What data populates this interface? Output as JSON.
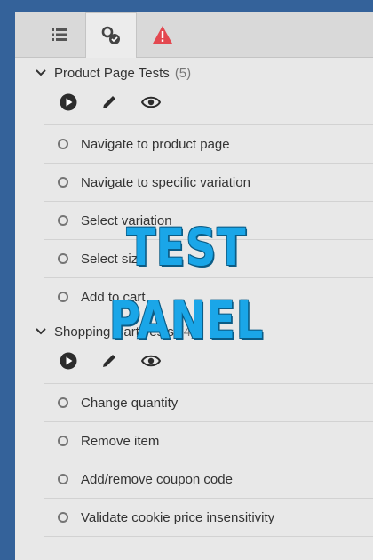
{
  "tabs": [
    {
      "icon": "list-icon"
    },
    {
      "icon": "test-status-icon",
      "active": true
    },
    {
      "icon": "warning-icon",
      "color": "#e34850"
    }
  ],
  "groups": [
    {
      "title": "Product Page Tests",
      "count": "(5)",
      "actions": [
        "play-icon",
        "pencil-icon",
        "eye-icon"
      ],
      "items": [
        "Navigate to product page",
        "Navigate to specific variation",
        "Select variation",
        "Select size",
        "Add to cart"
      ]
    },
    {
      "title": "Shopping Cart Tests",
      "count": "(4)",
      "actions": [
        "play-icon",
        "pencil-icon",
        "eye-icon"
      ],
      "items": [
        "Change quantity",
        "Remove item",
        "Add/remove coupon code",
        "Validate cookie price insensitivity"
      ]
    }
  ],
  "overlay": {
    "line1": "TEST",
    "line2": "PANEL"
  },
  "colors": {
    "overlay_text": "#1aa6e8",
    "background": "#34629a",
    "warning": "#e34850"
  }
}
